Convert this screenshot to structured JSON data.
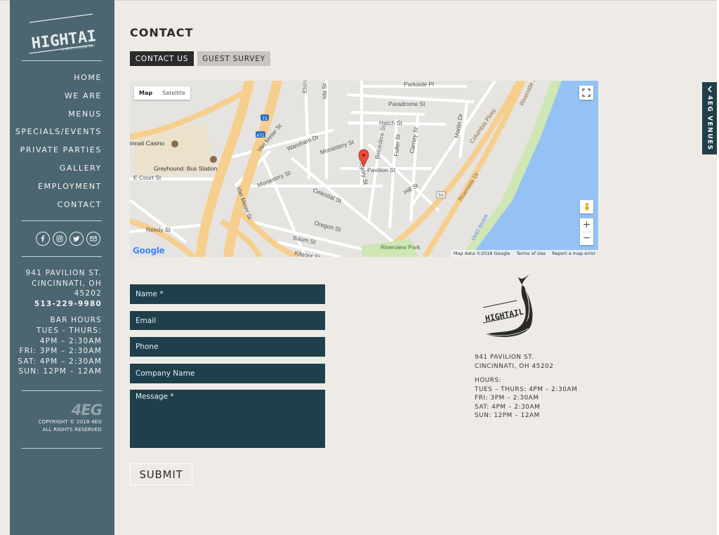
{
  "brand": {
    "logo_text": "HIGHTAIL",
    "logo_tagline": "a 4EG concept bar"
  },
  "sidebar": {
    "nav": [
      {
        "label": "HOME"
      },
      {
        "label": "WE ARE"
      },
      {
        "label": "MENUS"
      },
      {
        "label": "SPECIALS/EVENTS"
      },
      {
        "label": "PRIVATE PARTIES"
      },
      {
        "label": "GALLERY"
      },
      {
        "label": "EMPLOYMENT"
      },
      {
        "label": "CONTACT"
      }
    ],
    "social_icons": [
      "facebook-icon",
      "instagram-icon",
      "twitter-icon",
      "email-icon"
    ],
    "address_line1": "941 PAVILION ST.",
    "address_line2": "CINCINNATI, OH",
    "address_line3": "45202",
    "phone": "513-229-9980",
    "hours_title": "BAR HOURS",
    "hours": [
      "TUES - THURS:",
      "4PM – 2:30AM",
      "FRI: 3PM – 2:30AM",
      "SAT: 4PM – 2:30AM",
      "SUN: 12PM – 12AM"
    ],
    "footer_logo": "4EG",
    "copyright": "COPYRIGHT © 2018 4EG",
    "rights": "ALL RIGHTS RESERVED"
  },
  "main": {
    "title": "CONTACT",
    "tabs": [
      {
        "label": "CONTACT US",
        "active": true
      },
      {
        "label": "GUEST SURVEY",
        "active": false
      }
    ],
    "map": {
      "type_buttons": [
        "Map",
        "Satellite"
      ],
      "footer": [
        "Map data ©2018 Google",
        "Terms of Use",
        "Report a map error"
      ],
      "google_label": "Google",
      "labels": {
        "parkside": "Parkside Pl",
        "paradrome": "Paradrome St",
        "hatch": "Hatch St",
        "casino": "innati Casino",
        "greyhound": "Greyhound: Bus Station",
        "ecourt": "E Court St",
        "wareham": "Wareham Dr",
        "monastery1": "Monastery St",
        "monastery2": "Monastery St",
        "pavilion": "Pavilion St",
        "celestial": "Celestial St",
        "hill": "Hill St",
        "oregon": "Oregon St",
        "baum": "Baum St",
        "reedy": "Reedy St",
        "kilgour": "Kilgour St",
        "columbia": "Columbia Pkwy",
        "riverside": "Riverside Dr",
        "riverview": "Riverview Park",
        "vanmeter1": "Van Meter St",
        "vanmeter2": "Van Meter St",
        "ida": "Ida St",
        "elsin": "Elsin",
        "martin": "Martin Dr",
        "carney": "Carney St",
        "fuller": "Fuller St",
        "belvedere": "Belvedere St",
        "gregory": "Gregory St",
        "i71": "71",
        "i471": "471",
        "us50": "50",
        "ohio": "OHIO RIVER"
      }
    },
    "form": {
      "name_placeholder": "Name *",
      "email_placeholder": "Email",
      "phone_placeholder": "Phone",
      "company_placeholder": "Company Name",
      "message_placeholder": "Message *",
      "submit_label": "SUBMIT"
    },
    "info": {
      "address_line1": "941 PAVILION ST.",
      "address_line2": "CINCINNATI, OH 45202",
      "hours_title": "HOURS:",
      "hours": [
        "TUES – THURS: 4PM – 2:30AM",
        "FRI: 3PM – 2:30AM",
        "SAT: 4PM – 2:30AM",
        "SUN: 12PM – 12AM"
      ]
    }
  },
  "venues_tab": {
    "label": "4EG VENUES"
  },
  "colors": {
    "sidebar": "#4b6670",
    "field": "#1f404b",
    "background": "#eeebe6",
    "water": "#94c2f4",
    "highway": "#f6cf8f"
  }
}
